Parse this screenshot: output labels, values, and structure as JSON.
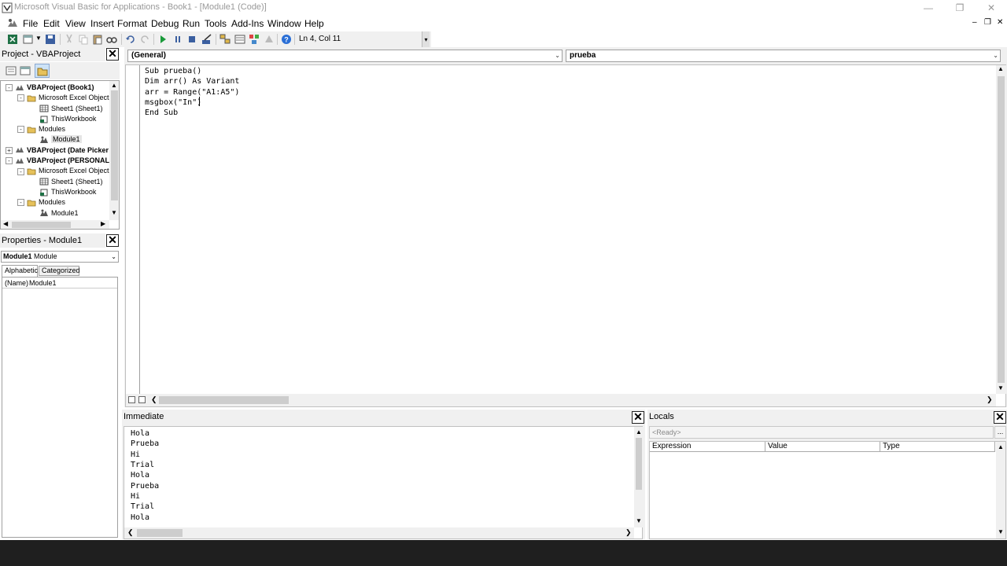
{
  "window": {
    "title": "Microsoft Visual Basic for Applications - Book1 - [Module1 (Code)]"
  },
  "menu": [
    "File",
    "Edit",
    "View",
    "Insert",
    "Format",
    "Debug",
    "Run",
    "Tools",
    "Add-Ins",
    "Window",
    "Help"
  ],
  "toolbar": {
    "status": "Ln 4, Col 11"
  },
  "project": {
    "title": "Project - VBAProject",
    "tree": [
      {
        "label": "VBAProject (Book1)",
        "bold": true
      },
      {
        "label": "Microsoft Excel Objects"
      },
      {
        "label": "Sheet1 (Sheet1)"
      },
      {
        "label": "ThisWorkbook"
      },
      {
        "label": "Modules"
      },
      {
        "label": "Module1"
      },
      {
        "label": "VBAProject (Date Picker",
        "bold": true
      },
      {
        "label": "VBAProject (PERSONAL.",
        "bold": true
      },
      {
        "label": "Microsoft Excel Objects"
      },
      {
        "label": "Sheet1 (Sheet1)"
      },
      {
        "label": "ThisWorkbook"
      },
      {
        "label": "Modules"
      },
      {
        "label": "Module1"
      }
    ]
  },
  "properties": {
    "title": "Properties - Module1",
    "object_name": "Module1",
    "object_type": "Module",
    "tabs": [
      "Alphabetic",
      "Categorized"
    ],
    "rows": [
      {
        "name": "(Name)",
        "value": "Module1"
      }
    ]
  },
  "code": {
    "object_combo": "(General)",
    "proc_combo": "prueba",
    "lines": [
      "Sub prueba()",
      "Dim arr() As Variant",
      "arr = Range(\"A1:A5\")",
      "msgbox(\"In\")",
      "End Sub"
    ]
  },
  "immediate": {
    "title": "Immediate",
    "lines": [
      "Hola",
      "Prueba",
      "Hi",
      "Trial",
      "Hola",
      "Prueba",
      "Hi",
      "Trial",
      "Hola"
    ]
  },
  "locals": {
    "title": "Locals",
    "status": "<Ready>",
    "ellipsis": "...",
    "columns": [
      "Expression",
      "Value",
      "Type"
    ]
  },
  "colors": {
    "panel": "#f0f0f0",
    "taskbar": "#1f1f1f"
  }
}
